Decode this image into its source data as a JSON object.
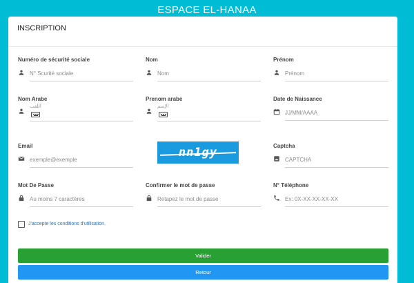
{
  "site_title": "ESPACE EL-HANAA",
  "form": {
    "title": "INSCRIPTION",
    "fields": {
      "ssn": {
        "label": "Numéro de sécurité sociale",
        "placeholder": "N° Scurité sociale",
        "icon": "person-icon"
      },
      "nom": {
        "label": "Nom",
        "placeholder": "Nom",
        "icon": "person-icon"
      },
      "prenom": {
        "label": "Prénom",
        "placeholder": "Prénom",
        "icon": "person-icon"
      },
      "nom_arabe": {
        "label": "Nom Arabe",
        "placeholder": "اللقب",
        "icon": "person-icon"
      },
      "prenom_arabe": {
        "label": "Prenom arabe",
        "placeholder": "الإسم",
        "icon": "person-icon"
      },
      "date_naissance": {
        "label": "Date de Naissance",
        "placeholder": "JJ/MM/AAAA",
        "icon": "calendar-icon"
      },
      "email": {
        "label": "Email",
        "placeholder": "exemple@exemple",
        "icon": "mail-icon"
      },
      "captcha": {
        "label": "Captcha",
        "placeholder": "CAPTCHA",
        "icon": "image-icon"
      },
      "mot_de_passe": {
        "label": "Mot De Passe",
        "placeholder": "Au moins 7 caractères",
        "icon": "lock-icon"
      },
      "confirmer": {
        "label": "Confirmer le mot de passe",
        "placeholder": "Retapez le mot de passe",
        "icon": "lock-icon"
      },
      "telephone": {
        "label": "N° Téléphone",
        "placeholder": "Ex: 0X-XX-XX-XX-XX",
        "icon": "phone-icon"
      }
    },
    "captcha_image_text": "nn1gy",
    "terms_label": "J'accepte les conditions d'utilisation.",
    "terms_checked": false,
    "buttons": {
      "valider": "Valider",
      "retour": "Retour"
    }
  },
  "colors": {
    "background": "#00bcd4",
    "valider": "#28a033",
    "retour": "#2196f3",
    "captcha_bg": "#1a9be0",
    "terms_text": "#2f6fb5"
  }
}
